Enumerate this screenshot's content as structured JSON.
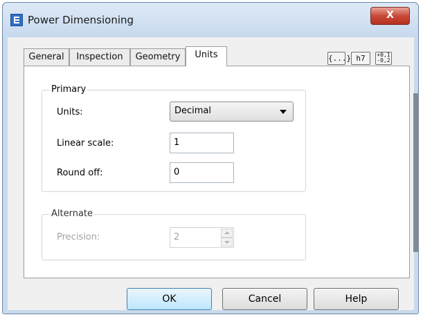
{
  "window": {
    "title": "Power Dimensioning",
    "close_glyph": "X"
  },
  "tabs": [
    {
      "label": "General",
      "active": false
    },
    {
      "label": "Inspection",
      "active": false
    },
    {
      "label": "Geometry",
      "active": false
    },
    {
      "label": "Units",
      "active": true
    }
  ],
  "toolbar_icons": [
    {
      "name": "braces-icon",
      "label": "{...}"
    },
    {
      "name": "tolerance-h7-icon",
      "label": "h7"
    },
    {
      "name": "tolerance-plus-minus-icon",
      "label": "+0,1/-0,2"
    }
  ],
  "primary": {
    "group_label": "Primary",
    "units_label": "Units:",
    "units_value": "Decimal",
    "linear_scale_label": "Linear scale:",
    "linear_scale_value": "1",
    "round_off_label": "Round off:",
    "round_off_value": "0"
  },
  "alternate": {
    "group_label": "Alternate",
    "precision_label": "Precision:",
    "precision_value": "2",
    "enabled": false
  },
  "buttons": {
    "ok": "OK",
    "cancel": "Cancel",
    "help": "Help"
  },
  "colors": {
    "frame": "#c9daed",
    "close_button": "#c8493a",
    "default_button": "#bee6fd"
  }
}
